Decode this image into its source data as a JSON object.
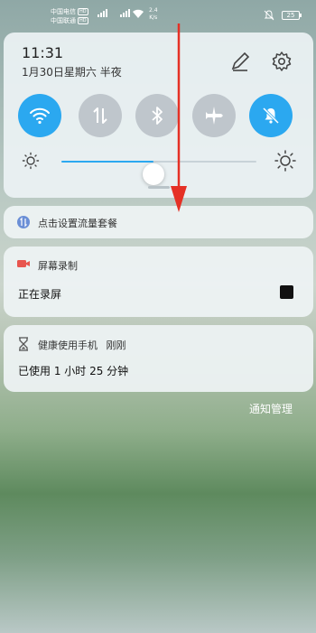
{
  "statusbar": {
    "carrier1": "中国电信",
    "carrier2": "中国联通",
    "hd_label": "HD",
    "net_type": "4G",
    "speed_value": "2.4",
    "speed_unit": "K/s",
    "battery": "25"
  },
  "quick_settings": {
    "time": "11:31",
    "date": "1月30日星期六 半夜",
    "toggles": [
      {
        "icon": "wifi-icon",
        "state": "on"
      },
      {
        "icon": "mobile-data-icon",
        "state": "off"
      },
      {
        "icon": "bluetooth-icon",
        "state": "off"
      },
      {
        "icon": "airplane-icon",
        "state": "off"
      },
      {
        "icon": "do-not-disturb-icon",
        "state": "on"
      }
    ],
    "brightness_fraction": 0.47
  },
  "notifications": {
    "data_plan": {
      "text": "点击设置流量套餐"
    },
    "screen_record": {
      "title": "屏幕录制",
      "body": "正在录屏"
    },
    "health": {
      "title": "健康使用手机",
      "time": "刚刚",
      "body": "已使用 1 小时 25 分钟"
    }
  },
  "footer": {
    "manage_label": "通知管理"
  },
  "colors": {
    "accent": "#2ba8f0",
    "record_icon": "#e8554e",
    "annotation_arrow": "#e53025"
  }
}
